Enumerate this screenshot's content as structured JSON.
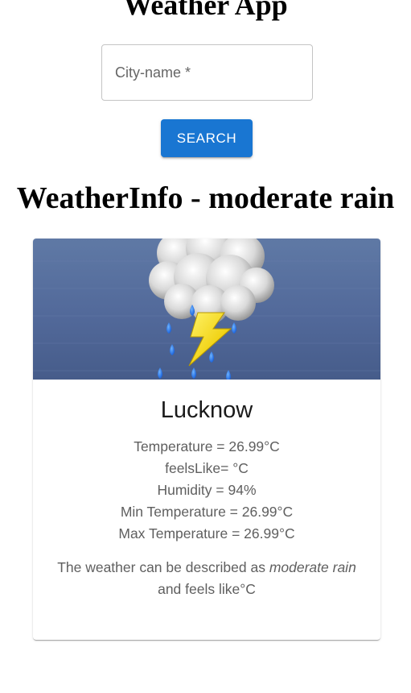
{
  "app": {
    "title": "Weather App"
  },
  "search": {
    "placeholder": "City-name *",
    "value": "",
    "button_label": "SEARCH"
  },
  "weather_info": {
    "heading": "WeatherInfo - moderate rain",
    "image_icon": "thunderstorm-cloud-icon",
    "city": "Lucknow",
    "temperature": "Temperature = 26.99°C",
    "feels_like": "feelsLike= °C",
    "humidity": "Humidity = 94%",
    "min_temperature": "Min Temperature = 26.99°C",
    "max_temperature": "Max Temperature = 26.99°C",
    "description_prefix": "The weather can be described as ",
    "description_condition": "moderate rain",
    "description_suffix": " and feels like°C"
  },
  "colors": {
    "primary": "#1976d2",
    "image_background": "#52699a",
    "text_secondary": "#5f5f5f"
  }
}
